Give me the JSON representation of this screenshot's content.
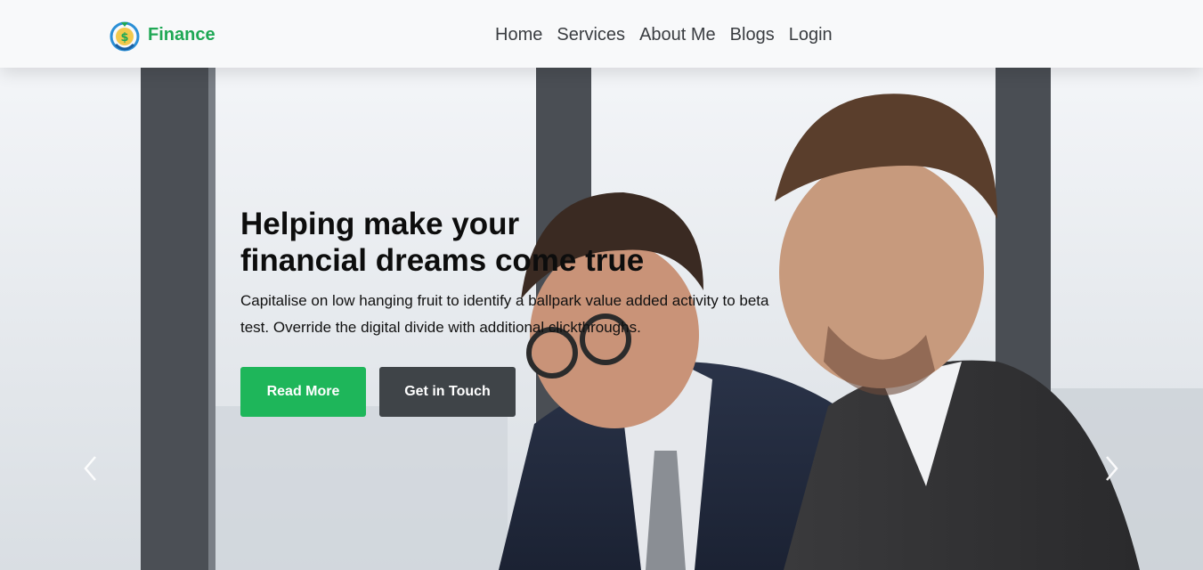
{
  "brand": {
    "name": "Finance",
    "logo_icon": "money-bag-dollar-icon",
    "color": "#1fa855"
  },
  "nav": {
    "items": [
      {
        "label": "Home"
      },
      {
        "label": "Services"
      },
      {
        "label": "About Me"
      },
      {
        "label": "Blogs"
      },
      {
        "label": "Login"
      }
    ]
  },
  "hero": {
    "title_line1": "Helping make your",
    "title_line2": "financial dreams come true",
    "text": "Capitalise on low hanging fruit to identify a ballpark value added activity to beta test. Override the digital divide with additional clickthroughs.",
    "primary_button": "Read More",
    "secondary_button": "Get in Touch",
    "primary_color": "#1eb65a",
    "secondary_color": "#3f4448",
    "background_image": "two-businessmen-office-photo",
    "prev_icon": "chevron-left-icon",
    "next_icon": "chevron-right-icon"
  }
}
